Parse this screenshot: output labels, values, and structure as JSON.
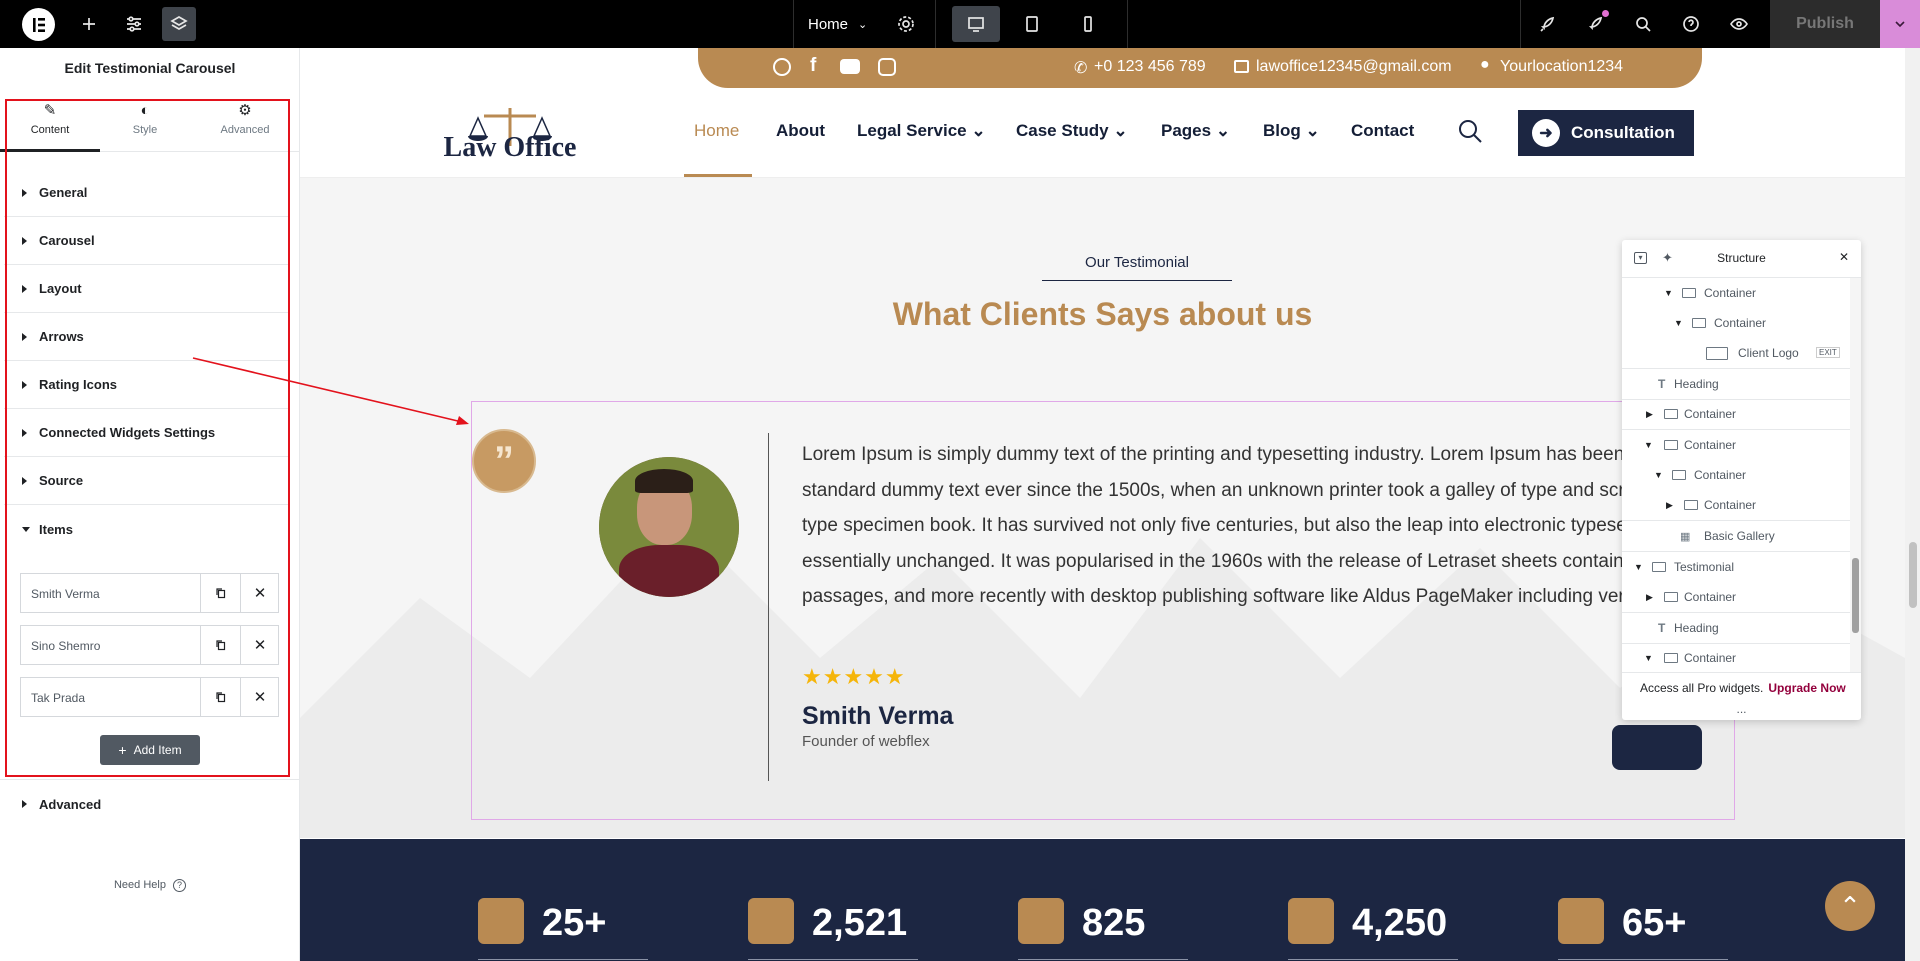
{
  "topbar": {
    "page_select": "Home",
    "publish": "Publish"
  },
  "panel": {
    "title": "Edit Testimonial Carousel",
    "tabs": [
      "Content",
      "Style",
      "Advanced"
    ],
    "sections": [
      "General",
      "Carousel",
      "Layout",
      "Arrows",
      "Rating Icons",
      "Connected Widgets Settings",
      "Source",
      "Items"
    ],
    "items": [
      "Smith Verma",
      "Sino Shemro",
      "Tak Prada"
    ],
    "add_item": "Add Item",
    "advanced": "Advanced",
    "need_help": "Need Help"
  },
  "site": {
    "phone": "+0 123 456 789",
    "email": "lawoffice12345@gmail.com",
    "location": "Yourlocation1234",
    "logo_text": "Law Office",
    "nav": [
      "Home",
      "About",
      "Legal Service",
      "Case Study",
      "Pages",
      "Blog",
      "Contact"
    ],
    "consultation": "Consultation",
    "subtitle": "Our Testimonial",
    "title": "What Clients Says about us",
    "quote": "Lorem Ipsum is simply dummy text of the printing and typesetting industry. Lorem Ipsum has been the industry's standard dummy text ever since the 1500s, when an unknown printer took a galley of type and scrambled it to make a type specimen book. It has survived not only five centuries, but also the leap into electronic typesetting, remaining essentially unchanged. It was popularised in the 1960s with the release of Letraset sheets containing Lorem Ipsum passages, and more recently with desktop publishing software like Aldus PageMaker including versions",
    "rating": 5,
    "author": "Smith Verma",
    "role": "Founder of webflex",
    "stats": [
      "25+",
      "2,521",
      "825",
      "4,250",
      "65+"
    ]
  },
  "structure": {
    "title": "Structure",
    "rows": [
      "Container",
      "Container",
      "Client Logo",
      "Heading",
      "Container",
      "Container",
      "Container",
      "Container",
      "Basic Gallery",
      "Testimonial",
      "Container",
      "Heading",
      "Container"
    ],
    "exit_badge": "EXIT",
    "footer_text": "Access all Pro widgets.",
    "footer_link": "Upgrade Now",
    "more": "..."
  },
  "colors": {
    "brand_gold": "#b98a52",
    "navy": "#1c2642",
    "annotation_red": "#e3121c"
  }
}
